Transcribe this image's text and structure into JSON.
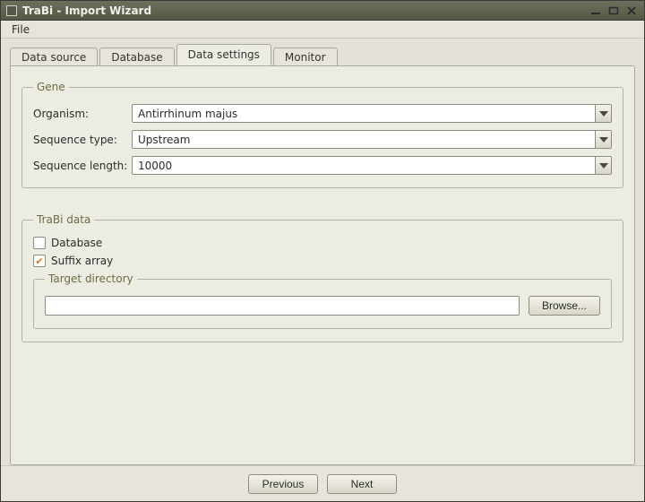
{
  "window": {
    "title": "TraBi - Import Wizard"
  },
  "menubar": {
    "file": "File"
  },
  "tabs": [
    {
      "label": "Data source",
      "active": false
    },
    {
      "label": "Database",
      "active": false
    },
    {
      "label": "Data settings",
      "active": true
    },
    {
      "label": "Monitor",
      "active": false
    }
  ],
  "gene_group": {
    "legend": "Gene",
    "organism_label": "Organism:",
    "organism_value": "Antirrhinum majus",
    "seqtype_label": "Sequence type:",
    "seqtype_value": "Upstream",
    "seqlen_label": "Sequence length:",
    "seqlen_value": "10000"
  },
  "trabi_group": {
    "legend": "TraBi data",
    "database_label": "Database",
    "database_checked": false,
    "suffix_label": "Suffix array",
    "suffix_checked": true,
    "target_legend": "Target directory",
    "target_value": "",
    "browse_label": "Browse..."
  },
  "footer": {
    "previous": "Previous",
    "next": "Next"
  }
}
